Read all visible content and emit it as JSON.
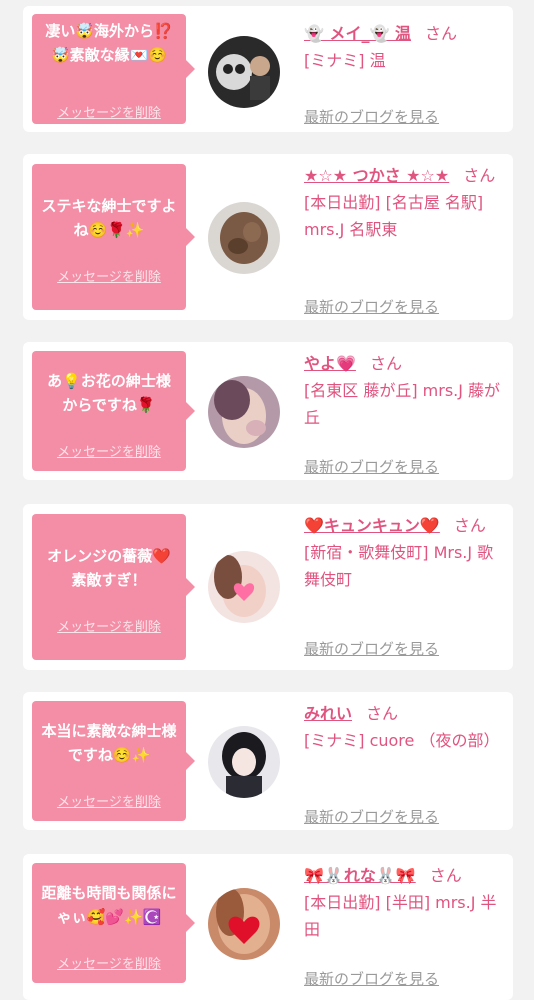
{
  "cards": [
    {
      "message": "凄い🤯海外から⁉️🤯素敵な縁💌☺️",
      "delete_label": "メッセージを削除",
      "name": "👻 メイ_👻 温",
      "san": "さん",
      "detail": "[ミナミ] 温",
      "blog_label": "最新のブログを見る"
    },
    {
      "message": "ステキな紳士ですよね☺️🌹✨",
      "delete_label": "メッセージを削除",
      "name": "★☆★ つかさ ★☆★",
      "san": "さん",
      "detail": "[本日出勤] [名古屋 名駅] mrs.J 名駅東",
      "blog_label": "最新のブログを見る"
    },
    {
      "message": "あ💡お花の紳士様からですね🌹",
      "delete_label": "メッセージを削除",
      "name": "やよ💗",
      "san": "さん",
      "detail": "[名東区 藤が丘] mrs.J 藤が丘",
      "blog_label": "最新のブログを見る"
    },
    {
      "message": "オレンジの薔薇❤️素敵すぎ！",
      "delete_label": "メッセージを削除",
      "name": "❤️キュンキュン❤️",
      "san": "さん",
      "detail": "[新宿・歌舞伎町] Mrs.J 歌舞伎町",
      "blog_label": "最新のブログを見る"
    },
    {
      "message": "本当に素敵な紳士様ですね☺️✨",
      "delete_label": "メッセージを削除",
      "name": "みれい",
      "san": "さん",
      "detail": "[ミナミ] cuore （夜の部）",
      "blog_label": "最新のブログを見る"
    },
    {
      "message": "距離も時間も関係にゃぃ🥰💕✨☪️",
      "delete_label": "メッセージを削除",
      "name": "🎀🐰れな🐰🎀",
      "san": "さん",
      "detail": "[本日出勤] [半田] mrs.J 半田",
      "blog_label": "最新のブログを見る"
    }
  ],
  "colors": {
    "accent": "#f38ea6",
    "name_text": "#e05480",
    "link_gray": "#9a9a9a"
  }
}
